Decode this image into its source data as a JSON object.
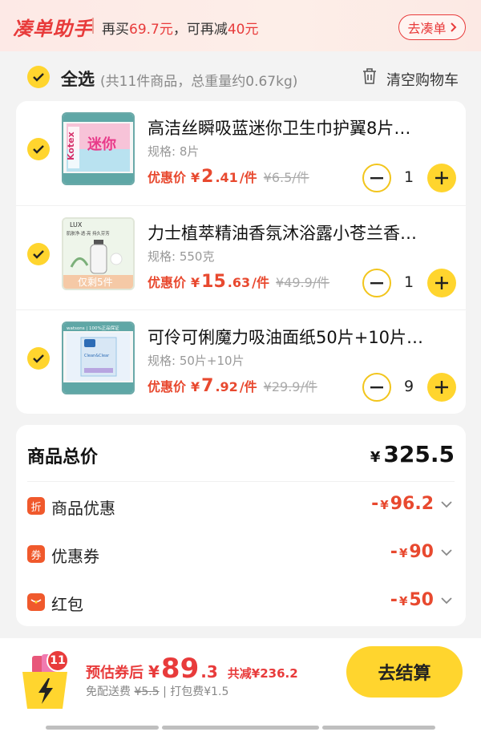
{
  "topbar": {
    "brand": "凑单助手",
    "promo_prefix": "再买",
    "promo_amount": "69.7元",
    "promo_middle": "，可再减",
    "promo_discount": "40元",
    "go_label": "去凑单"
  },
  "select_bar": {
    "select_all": "全选",
    "meta": "(共11件商品，总重量约0.67kg)",
    "clear": "清空购物车"
  },
  "items": [
    {
      "title": "高洁丝瞬吸蓝迷你卫生巾护翼8片…",
      "spec": "规格: 8片",
      "price_label": "优惠价",
      "currency": "¥",
      "price_int": "2",
      "price_dec": ".41",
      "unit": "/件",
      "original": "¥6.5/件",
      "qty": "1",
      "thumb": {
        "brand": "Kotex",
        "text": "迷你",
        "header": "超值装 | 100%正品保证",
        "colors": [
          "#f7c3d8",
          "#b9e2f0"
        ]
      }
    },
    {
      "title": "力士植萃精油香氛沐浴露小苍兰香…",
      "spec": "规格: 550克",
      "price_label": "优惠价",
      "currency": "¥",
      "price_int": "15",
      "price_dec": ".63",
      "unit": "/件",
      "original": "¥49.9/件",
      "qty": "1",
      "thumb": {
        "brand": "LUX",
        "text": "肌肤净·透·亮 持久芬芳",
        "footer": "仅剩5件",
        "colors": [
          "#e9f4e4",
          "#f3f3ee"
        ]
      }
    },
    {
      "title": "可伶可俐魔力吸油面纸50片+10片…",
      "spec": "规格: 50片+10片",
      "price_label": "优惠价",
      "currency": "¥",
      "price_int": "7",
      "price_dec": ".92",
      "unit": "/件",
      "original": "¥29.9/件",
      "qty": "9",
      "thumb": {
        "brand": "Clean&Clear",
        "header": "watsons | 100%正品保证",
        "colors": [
          "#d8e7f5",
          "#9bc7e6"
        ]
      }
    }
  ],
  "summary": {
    "title": "商品总价",
    "currency": "¥",
    "total": "325.5",
    "rows": [
      {
        "icon": "折",
        "label": "商品优惠",
        "prefix": "-",
        "currency": "¥",
        "amount": "96.2"
      },
      {
        "icon": "券",
        "label": "优惠券",
        "prefix": "-",
        "currency": "¥",
        "amount": "90"
      },
      {
        "icon": "",
        "label": "红包",
        "prefix": "-",
        "currency": "¥",
        "amount": "50"
      }
    ]
  },
  "footer": {
    "badge": "11",
    "est_label": "预估券后",
    "currency": "¥",
    "est_int": "89",
    "est_dec": ".3",
    "saved": "共减¥236.2",
    "ship_text": "免配送费",
    "ship_orig": "¥5.5",
    "pack": "| 打包费¥1.5",
    "checkout": "去结算"
  },
  "colors": {
    "accent_yellow": "#ffd52e",
    "price_red": "#e8492f",
    "brand_red": "#e83b3b"
  }
}
